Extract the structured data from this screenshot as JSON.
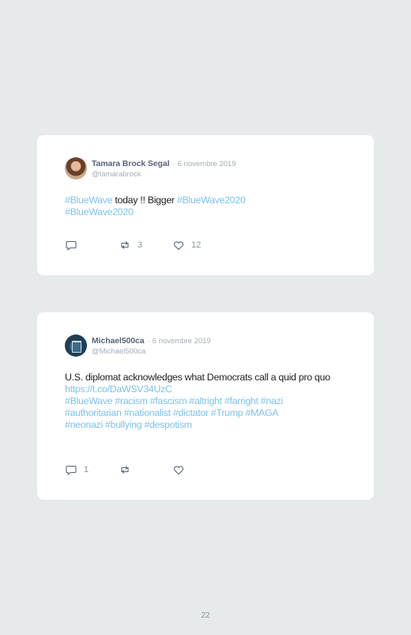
{
  "tweets": [
    {
      "author": "Tamara Brock Segal",
      "date": "· 6 novembre 2019",
      "handle": "@tamarabrock",
      "text": {
        "tag1": "#BlueWave",
        "t1": " today !! Bigger ",
        "tag2": "#BlueWave2020",
        "tag3": "#BlueWave2020"
      },
      "replies": "",
      "retweets": "3",
      "likes": "12"
    },
    {
      "author": "Michael500ca",
      "date": "· 6 novembre 2019",
      "handle": "@Michael500ca",
      "text": {
        "line1": "U.S. diplomat acknowledges what Democrats call a quid pro quo",
        "link": "https://t.co/DaWSV34UzC",
        "tags1": "#BlueWave #racism #fascism #altright #farright #nazi",
        "tags2": "#authoritarian #nationalist #dictator #Trump #MAGA",
        "tags3": "#neonazi #bullying #despotism"
      },
      "replies": "1",
      "retweets": "",
      "likes": ""
    }
  ],
  "page_number": "22"
}
